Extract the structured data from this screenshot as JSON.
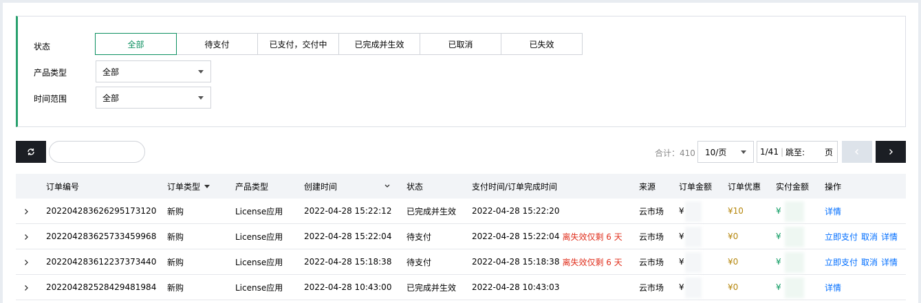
{
  "filter": {
    "status_label": "状态",
    "status_options": [
      "全部",
      "待支付",
      "已支付，交付中",
      "已完成并生效",
      "已取消",
      "已失效"
    ],
    "status_selected": "全部",
    "product_type_label": "产品类型",
    "product_type_value": "全部",
    "time_range_label": "时间范围",
    "time_range_value": "全部"
  },
  "toolbar": {
    "search_placeholder": "",
    "total_text": "合计：410",
    "page_size": "10/页",
    "page_info": "1/41",
    "jump_label": "跳至:",
    "jump_unit": "页"
  },
  "table": {
    "headers": {
      "order_id": "订单编号",
      "order_type": "订单类型",
      "product_type": "产品类型",
      "created": "创建时间",
      "status": "状态",
      "paid_time": "支付时间/订单完成时间",
      "source": "来源",
      "amount": "订单金额",
      "discount": "订单优惠",
      "paid_amount": "实付金额",
      "actions": "操作"
    },
    "rows": [
      {
        "order_id": "20220428362629517312​0",
        "order_type": "新购",
        "product_type": "License应用",
        "created": "2022-04-28 15:22:12",
        "status": "已完成并生效",
        "paid_time": "2022-04-28 15:22:20",
        "expire_note": "",
        "source": "云市场",
        "amount": "¥",
        "discount": "¥10",
        "paid_amount": "¥",
        "actions": [
          "详情"
        ]
      },
      {
        "order_id": "20220428362573345996​8",
        "order_type": "新购",
        "product_type": "License应用",
        "created": "2022-04-28 15:22:04",
        "status": "待支付",
        "paid_time": "2022-04-28 15:22:04",
        "expire_note": "离失效仅剩 6 天",
        "source": "云市场",
        "amount": "¥",
        "discount": "¥0",
        "paid_amount": "¥",
        "actions": [
          "立即支付",
          "取消",
          "详情"
        ]
      },
      {
        "order_id": "20220428361223737344​0",
        "order_type": "新购",
        "product_type": "License应用",
        "created": "2022-04-28 15:18:38",
        "status": "待支付",
        "paid_time": "2022-04-28 15:18:38",
        "expire_note": "离失效仅剩 6 天",
        "source": "云市场",
        "amount": "¥",
        "discount": "¥0",
        "paid_amount": "¥",
        "actions": [
          "立即支付",
          "取消",
          "详情"
        ]
      },
      {
        "order_id": "20220428252842948198​4",
        "order_type": "新购",
        "product_type": "License应用",
        "created": "2022-04-28 10:43:00",
        "status": "已完成并生效",
        "paid_time": "2022-04-28 10:43:03",
        "expire_note": "",
        "source": "云市场",
        "amount": "¥",
        "discount": "¥0",
        "paid_amount": "¥",
        "actions": [
          "详情"
        ]
      }
    ]
  },
  "colors": {
    "accent": "#0a8f5f",
    "link": "#006eff",
    "warning": "#e0301e",
    "discount": "#b5860b"
  }
}
